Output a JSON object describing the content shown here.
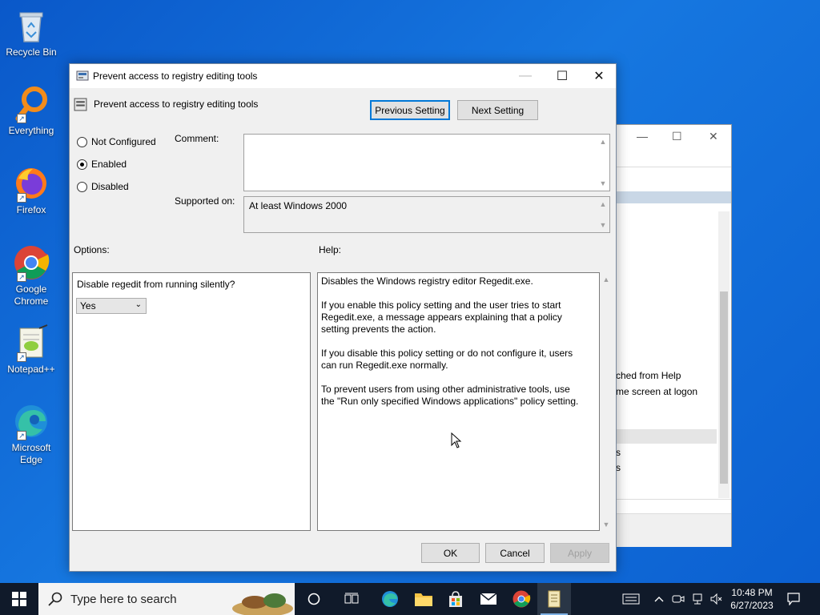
{
  "desktop": {
    "icons": [
      {
        "label": "Recycle Bin"
      },
      {
        "label": "Everything"
      },
      {
        "label": "Firefox"
      },
      {
        "label": "Google Chrome"
      },
      {
        "label": "Notepad++"
      },
      {
        "label": "Microsoft Edge"
      }
    ]
  },
  "background_window": {
    "fragments": [
      "ched from Help",
      "me screen at logon",
      "s",
      "s"
    ]
  },
  "dialog": {
    "window_title": "Prevent access to registry editing tools",
    "header_title": "Prevent access to registry editing tools",
    "prev_label": "Previous Setting",
    "next_label": "Next Setting",
    "radios": {
      "not_configured": "Not Configured",
      "enabled": "Enabled",
      "disabled": "Disabled"
    },
    "selected_state": "Enabled",
    "comment_label": "Comment:",
    "comment_value": "",
    "supported_label": "Supported on:",
    "supported_value": "At least Windows 2000",
    "options_label": "Options:",
    "help_label": "Help:",
    "option_question": "Disable regedit from running silently?",
    "option_value": "Yes",
    "help_paragraphs": [
      "Disables the Windows registry editor Regedit.exe.",
      "If you enable this policy setting and the user tries to start Regedit.exe, a message appears explaining that a policy setting prevents the action.",
      "If you disable this policy setting or do not configure it, users can run Regedit.exe normally.",
      "To prevent users from using other administrative tools, use the \"Run only specified Windows applications\" policy setting."
    ],
    "ok_label": "OK",
    "cancel_label": "Cancel",
    "apply_label": "Apply"
  },
  "taskbar": {
    "search_placeholder": "Type here to search",
    "time": "10:48 PM",
    "date": "6/27/2023"
  },
  "colors": {
    "accent": "#0078d7",
    "desktop": "#1677e0",
    "taskbar": "#101a2a"
  }
}
